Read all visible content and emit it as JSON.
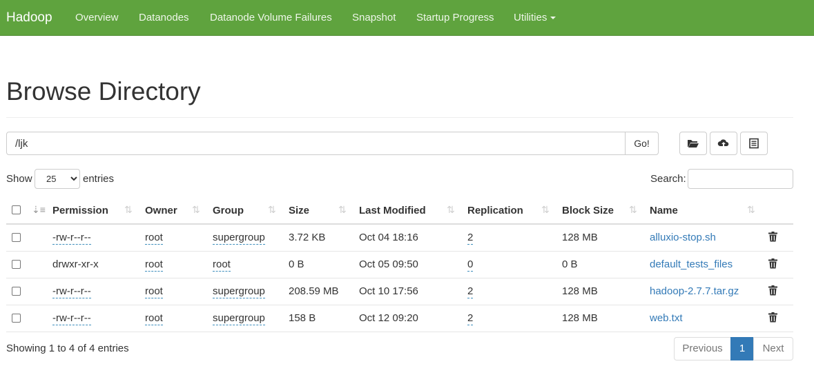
{
  "navbar": {
    "brand": "Hadoop",
    "items": [
      "Overview",
      "Datanodes",
      "Datanode Volume Failures",
      "Snapshot",
      "Startup Progress",
      "Utilities"
    ],
    "color": "#5fa33e"
  },
  "page_title": "Browse Directory",
  "path_bar": {
    "value": "/ljk",
    "go_label": "Go!"
  },
  "toolbar": {
    "icons": [
      "folder-open-icon",
      "cloud-upload-icon",
      "list-alt-icon"
    ]
  },
  "length": {
    "show_label": "Show",
    "selected": "25",
    "entries_label": "entries"
  },
  "search": {
    "label": "Search:"
  },
  "table": {
    "columns": [
      "Permission",
      "Owner",
      "Group",
      "Size",
      "Last Modified",
      "Replication",
      "Block Size",
      "Name"
    ],
    "rows": [
      {
        "permission": "-rw-r--r--",
        "owner": "root",
        "group": "supergroup",
        "size": "3.72 KB",
        "modified": "Oct 04 18:16",
        "replication": "2",
        "block_size": "128 MB",
        "name": "alluxio-stop.sh"
      },
      {
        "permission": "drwxr-xr-x",
        "owner": "root",
        "group": "root",
        "size": "0 B",
        "modified": "Oct 05 09:50",
        "replication": "0",
        "block_size": "0 B",
        "name": "default_tests_files"
      },
      {
        "permission": "-rw-r--r--",
        "owner": "root",
        "group": "supergroup",
        "size": "208.59 MB",
        "modified": "Oct 10 17:56",
        "replication": "2",
        "block_size": "128 MB",
        "name": "hadoop-2.7.7.tar.gz"
      },
      {
        "permission": "-rw-r--r--",
        "owner": "root",
        "group": "supergroup",
        "size": "158 B",
        "modified": "Oct 12 09:20",
        "replication": "2",
        "block_size": "128 MB",
        "name": "web.txt"
      }
    ]
  },
  "footer": {
    "info": "Showing 1 to 4 of 4 entries",
    "previous": "Previous",
    "page": "1",
    "next": "Next",
    "active_color": "#337ab7"
  }
}
